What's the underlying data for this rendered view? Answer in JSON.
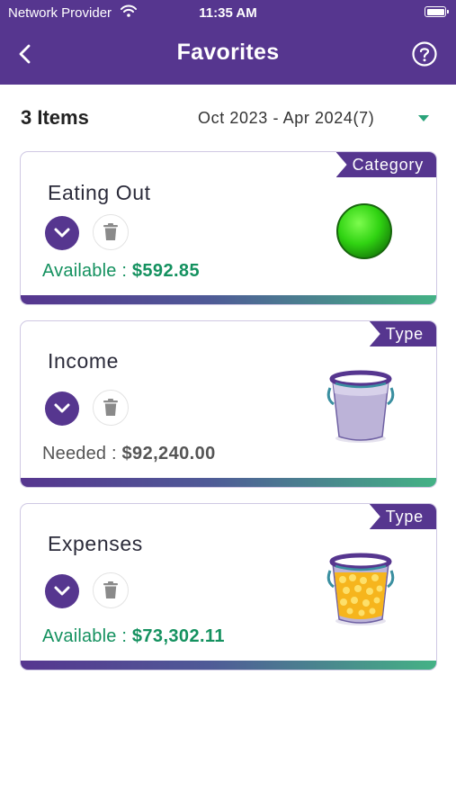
{
  "status_bar": {
    "carrier": "Network Provider",
    "time": "11:35 AM"
  },
  "header": {
    "title": "Favorites",
    "back_icon": "chevron-left-icon",
    "help_icon": "question-circle-icon"
  },
  "summary": {
    "count_label": "3 Items",
    "period": "Oct 2023 - Apr 2024(7)"
  },
  "colors": {
    "brand": "#56368f",
    "positive": "#14915f",
    "neutral": "#555555"
  },
  "cards": [
    {
      "ribbon": "Category",
      "name": "Eating Out",
      "amount_label": "Available : ",
      "amount": "$592.85",
      "icon": "green-dot-icon"
    },
    {
      "ribbon": "Type",
      "name": "Income",
      "amount_label": "Needed : ",
      "amount": "$92,240.00",
      "icon": "empty-bucket-icon"
    },
    {
      "ribbon": "Type",
      "name": "Expenses",
      "amount_label": "Available : ",
      "amount": "$73,302.11",
      "icon": "coin-bucket-icon"
    }
  ]
}
